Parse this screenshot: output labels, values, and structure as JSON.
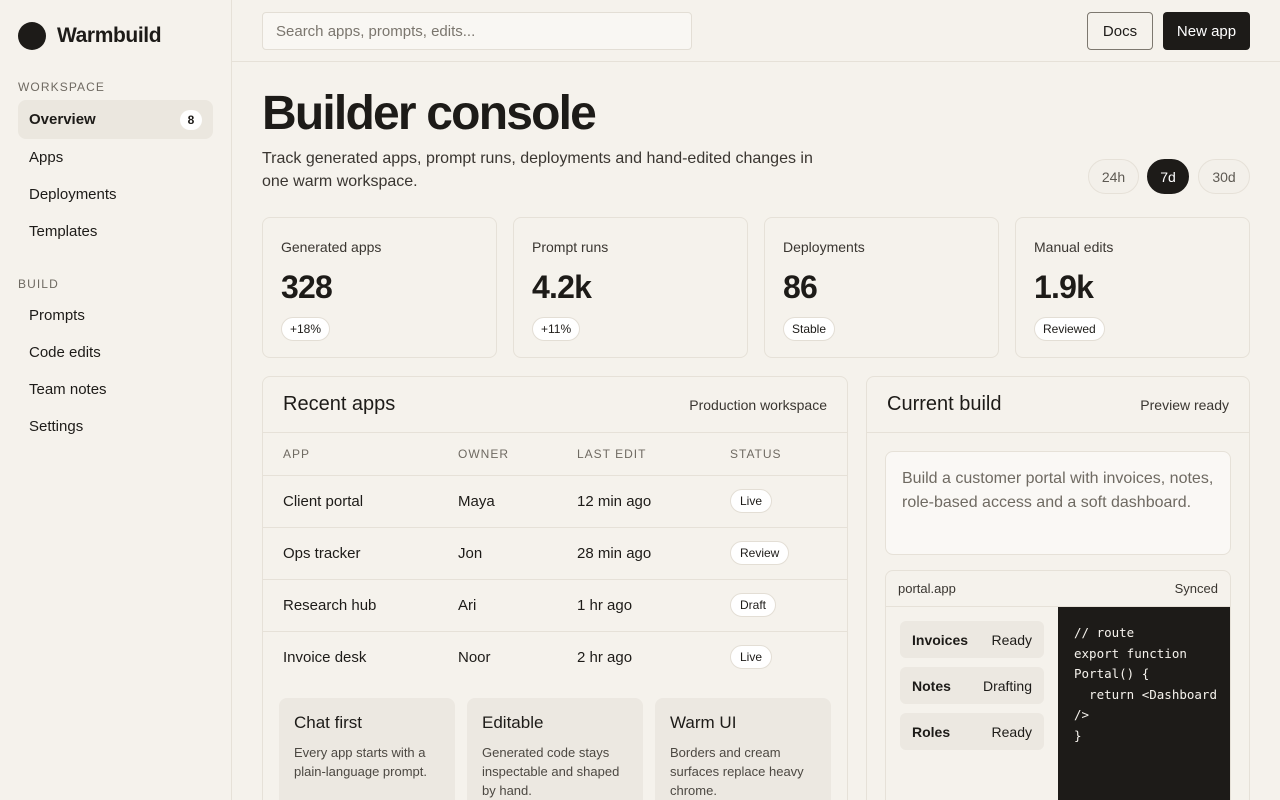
{
  "brand": {
    "name": "Warmbuild"
  },
  "sidebar": {
    "workspace_label": "Workspace",
    "workspace_items": [
      {
        "label": "Overview",
        "badge": "8",
        "active": true
      },
      {
        "label": "Apps"
      },
      {
        "label": "Deployments"
      },
      {
        "label": "Templates"
      }
    ],
    "build_label": "Build",
    "build_items": [
      {
        "label": "Prompts"
      },
      {
        "label": "Code edits"
      },
      {
        "label": "Team notes"
      },
      {
        "label": "Settings"
      }
    ]
  },
  "topbar": {
    "search_placeholder": "Search apps, prompts, edits...",
    "docs_label": "Docs",
    "new_app_label": "New app"
  },
  "header": {
    "title": "Builder console",
    "subtitle": "Track generated apps, prompt runs, deployments and hand-edited changes in one warm workspace.",
    "ranges": [
      "24h",
      "7d",
      "30d"
    ],
    "active_range": "7d"
  },
  "stats": [
    {
      "label": "Generated apps",
      "value": "328",
      "chip": "+18%"
    },
    {
      "label": "Prompt runs",
      "value": "4.2k",
      "chip": "+11%"
    },
    {
      "label": "Deployments",
      "value": "86",
      "chip": "Stable"
    },
    {
      "label": "Manual edits",
      "value": "1.9k",
      "chip": "Reviewed"
    }
  ],
  "recent_apps": {
    "title": "Recent apps",
    "meta": "Production workspace",
    "columns": [
      "App",
      "Owner",
      "Last edit",
      "Status"
    ],
    "rows": [
      {
        "app": "Client portal",
        "owner": "Maya",
        "last_edit": "12 min ago",
        "status": "Live"
      },
      {
        "app": "Ops tracker",
        "owner": "Jon",
        "last_edit": "28 min ago",
        "status": "Review"
      },
      {
        "app": "Research hub",
        "owner": "Ari",
        "last_edit": "1 hr ago",
        "status": "Draft"
      },
      {
        "app": "Invoice desk",
        "owner": "Noor",
        "last_edit": "2 hr ago",
        "status": "Live"
      }
    ]
  },
  "features": [
    {
      "title": "Chat first",
      "body": "Every app starts with a plain-language prompt."
    },
    {
      "title": "Editable",
      "body": "Generated code stays inspectable and shaped by hand."
    },
    {
      "title": "Warm UI",
      "body": "Borders and cream surfaces replace heavy chrome."
    }
  ],
  "current_build": {
    "title": "Current build",
    "meta": "Preview ready",
    "prompt": "Build a customer portal with invoices, notes, role-based access and a soft dashboard.",
    "preview_name": "portal.app",
    "preview_status": "Synced",
    "routes": [
      {
        "name": "Invoices",
        "status": "Ready"
      },
      {
        "name": "Notes",
        "status": "Drafting"
      },
      {
        "name": "Roles",
        "status": "Ready"
      }
    ],
    "code": "// route\nexport function\nPortal() {\n  return <Dashboard\n/>\n}"
  }
}
